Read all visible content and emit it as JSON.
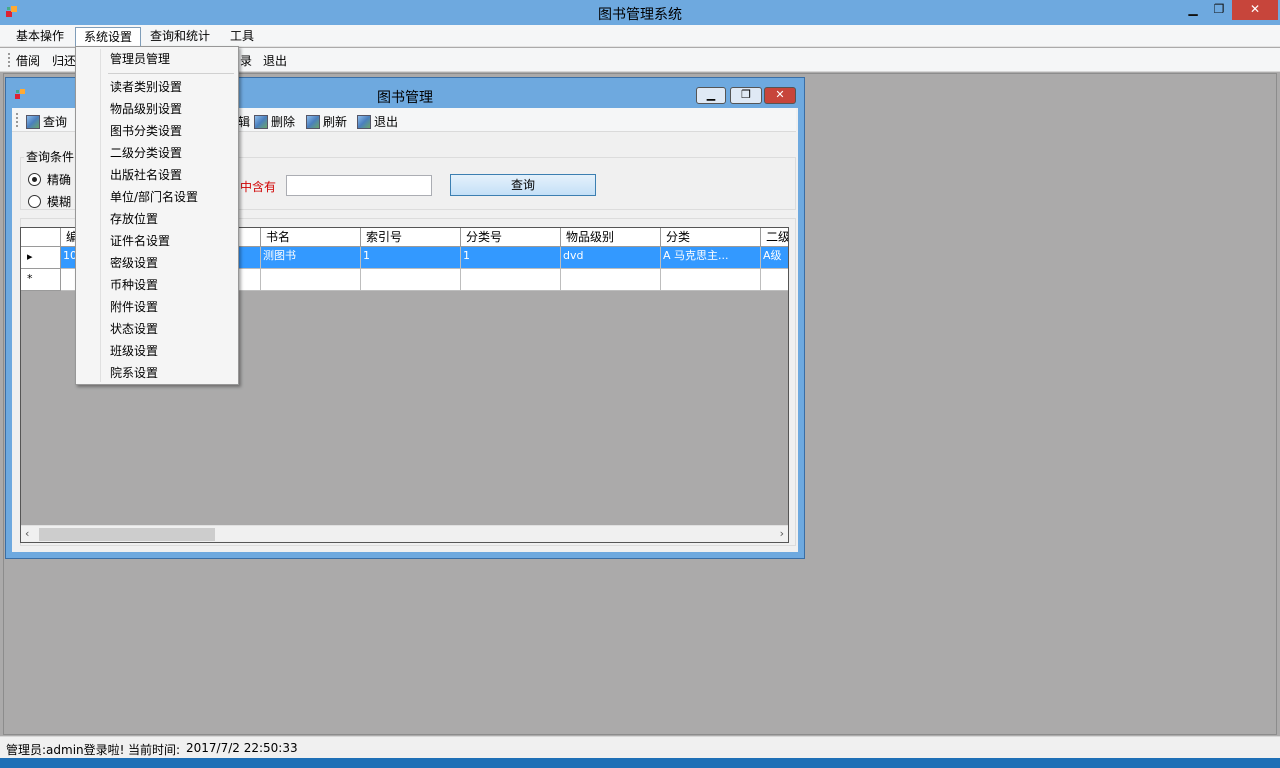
{
  "app": {
    "title": "图书管理系统",
    "window_controls": {
      "minimize": "▁",
      "restore": "❐",
      "close": "✕"
    }
  },
  "menubar": {
    "items": [
      "基本操作",
      "系统设置",
      "查询和统计",
      "工具"
    ]
  },
  "toolbar": {
    "items": [
      "借阅",
      "归还",
      "录",
      "退出"
    ]
  },
  "system_menu": {
    "items": [
      "管理员管理",
      "读者类别设置",
      "物品级别设置",
      "图书分类设置",
      "二级分类设置",
      "出版社名设置",
      "单位/部门名设置",
      "存放位置",
      "证件名设置",
      "密级设置",
      "币种设置",
      "附件设置",
      "状态设置",
      "班级设置",
      "院系设置"
    ]
  },
  "child": {
    "title": "图书管理",
    "toolbar": {
      "query": "查询",
      "tail": "辑",
      "delete": "删除",
      "refresh": "刷新",
      "exit": "退出"
    },
    "query": {
      "group_label": "查询条件",
      "mode_exact": "精确",
      "mode_fuzzy": "模糊",
      "contains_label": "中含有",
      "search_value": "",
      "button": "查询"
    },
    "grid": {
      "columns": [
        "编",
        "书名",
        "索引号",
        "分类号",
        "物品级别",
        "分类",
        "二级"
      ],
      "row1": {
        "indicator": "▸",
        "id": "10",
        "title": "测图书",
        "index_no": "1",
        "class_no": "1",
        "level": "dvd",
        "category": "A  马克思主...",
        "subcat": "A级"
      },
      "new_row_indicator": "*"
    }
  },
  "status": {
    "user": "管理员:admin登录啦!",
    "time_label": "当前时间:",
    "time": "2017/7/2 22:50:33"
  }
}
